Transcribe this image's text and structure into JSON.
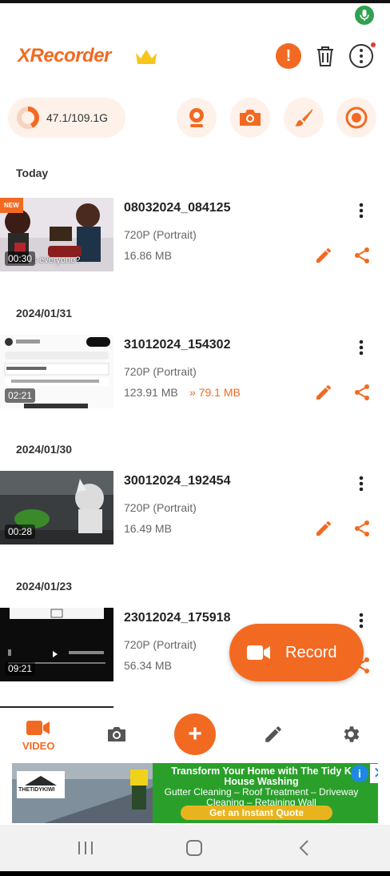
{
  "app": {
    "title": "XRecorder"
  },
  "header": {
    "alert_icon": "alert-icon",
    "trash_icon": "trash-icon",
    "more_icon": "more-vert-icon"
  },
  "storage": {
    "text": "47.1/109.1G",
    "used_fraction": 0.43
  },
  "quick_actions": [
    "webcam-icon",
    "screenshot-camera-icon",
    "brush-icon",
    "record-circle-icon"
  ],
  "sections": [
    {
      "label": "Today"
    },
    {
      "label": "2024/01/31"
    },
    {
      "label": "2024/01/30"
    },
    {
      "label": "2024/01/23"
    }
  ],
  "videos": [
    {
      "name": "08032024_084125",
      "resolution": "720P (Portrait)",
      "size": "16.86 MB",
      "duration": "00:30",
      "badge": "NEW",
      "thumb_caption": "is everyone?"
    },
    {
      "name": "31012024_154302",
      "resolution": "720P (Portrait)",
      "size": "123.91 MB",
      "compressed": "» 79.1 MB",
      "duration": "02:21"
    },
    {
      "name": "30012024_192454",
      "resolution": "720P (Portrait)",
      "size": "16.49 MB",
      "duration": "00:28"
    },
    {
      "name": "23012024_175918",
      "resolution": "720P (Portrait)",
      "size": "56.34 MB",
      "duration": "09:21"
    }
  ],
  "fab": {
    "label": "Record"
  },
  "bottom_nav": {
    "video_label": "VIDEO"
  },
  "ad": {
    "title": "Transform Your Home with The Tidy K House Washing",
    "text": "Gutter Cleaning – Roof Treatment – Driveway Cleaning – Retaining Wall",
    "cta": "Get an Instant Quote",
    "brand": "THETIDYKIWI"
  },
  "colors": {
    "accent": "#f26a21",
    "ad_green": "#2aa02a"
  }
}
